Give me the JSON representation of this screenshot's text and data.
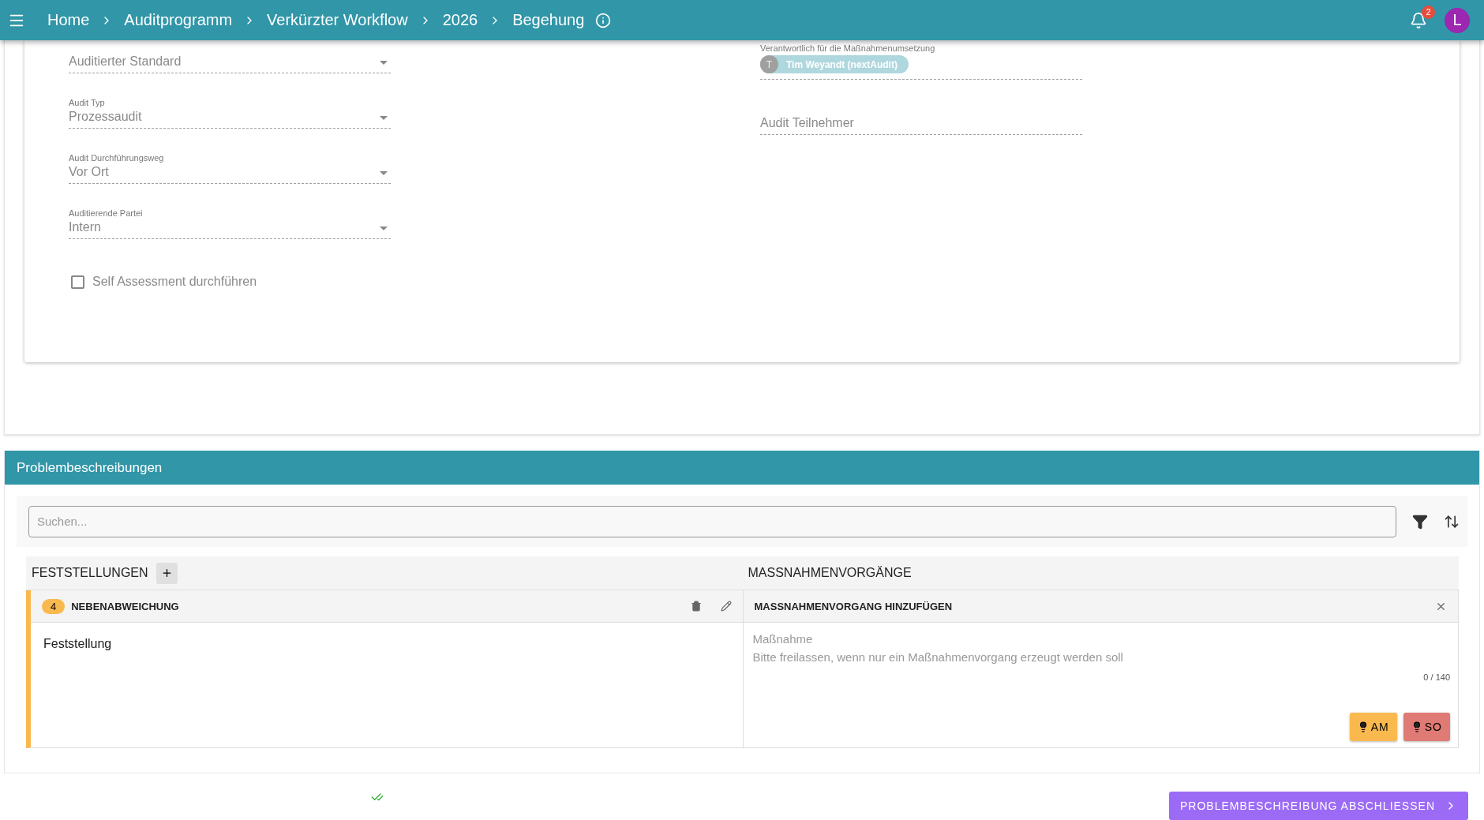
{
  "header": {
    "breadcrumbs": [
      "Home",
      "Auditprogramm",
      "Verkürzter Workflow",
      "2026",
      "Begehung"
    ],
    "notification_count": "2",
    "avatar": "L"
  },
  "audit_form": {
    "left_fields": [
      {
        "kind": "select",
        "placeholder": "Auditierter Standard"
      },
      {
        "kind": "select",
        "label": "Audit Typ",
        "value": "Prozessaudit"
      },
      {
        "kind": "select",
        "label": "Audit Durchführungsweg",
        "value": "Vor Ort"
      },
      {
        "kind": "select",
        "label": "Auditierende Partei",
        "value": "Intern"
      }
    ],
    "checkbox": {
      "label": "Self Assessment durchführen",
      "checked": false
    },
    "right_fields": [
      {
        "kind": "chips",
        "label": "Verantwortlich für die Maßnahmenumsetzung",
        "chips": [
          {
            "initial": "T",
            "text": "Tim Weyandt (nextAudit)"
          }
        ]
      },
      {
        "kind": "text",
        "placeholder": "Audit Teilnehmer"
      }
    ]
  },
  "problems": {
    "title": "Problembeschreibungen",
    "search": {
      "placeholder": "Suchen..."
    },
    "columns": [
      "FESTSTELLUNGEN",
      "MASSNAHMENVORGÄNGE"
    ],
    "findings": [
      {
        "number": "4",
        "type": "NEBENABWEICHUNG",
        "color": "#f9b94f",
        "text": "Feststellung"
      }
    ],
    "action_form": {
      "title": "MASSNAHMENVORGANG HINZUFÜGEN",
      "label": "Maßnahme",
      "placeholder": "Bitte freilassen, wenn nur ein Maßnahmenvorgang erzeugt werden soll",
      "counter": "0 / 140",
      "buttons": [
        {
          "label": "AM",
          "color": "#f9b94f"
        },
        {
          "label": "SO",
          "color": "#e07a74"
        }
      ]
    }
  },
  "footer": {
    "button": "PROBLEMBESCHREIBUNG ABSCHLIESSEN"
  }
}
